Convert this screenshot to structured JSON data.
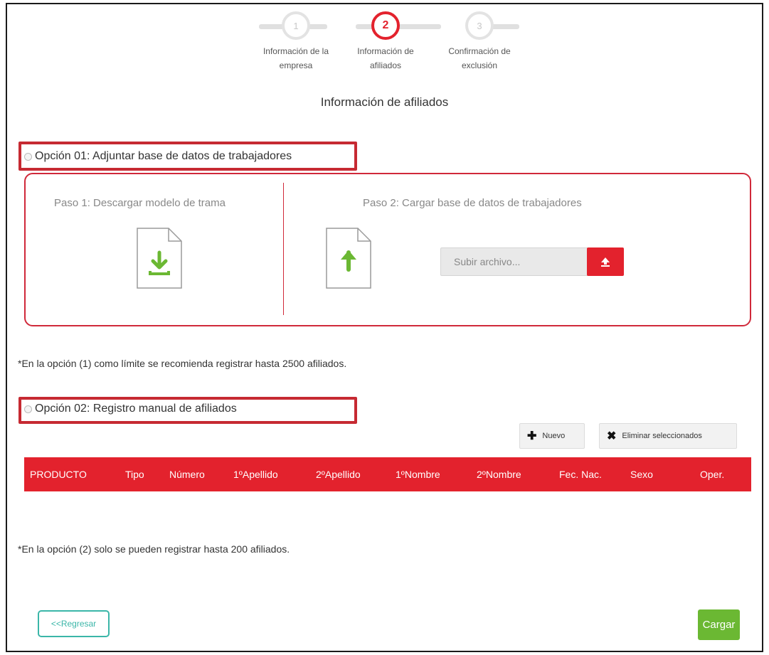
{
  "stepper": {
    "steps": [
      {
        "number": "1",
        "label": "Información de la\nempresa",
        "state": "inactive"
      },
      {
        "number": "2",
        "label": "Información de\nafiliados",
        "state": "active"
      },
      {
        "number": "3",
        "label": "Confirmación de\nexclusión",
        "state": "inactive"
      }
    ]
  },
  "page_title": "Información de afiliados",
  "option1": {
    "title": "Opción 01: Adjuntar base de datos de trabajadores",
    "step1_title": "Paso 1: Descargar modelo de trama",
    "step2_title": "Paso 2: Cargar base de datos de trabajadores",
    "file_input_text": "Subir archivo...",
    "note": "*En la opción (1) como límite se recomienda registrar hasta 2500 afiliados."
  },
  "option2": {
    "title": "Opción 02: Registro manual de afiliados",
    "new_button": "Nuevo",
    "delete_button": "Eliminar seleccionados",
    "columns": [
      "PRODUCTO",
      "Tipo",
      "Número",
      "1ºApellido",
      "2ºApellido",
      "1ºNombre",
      "2ºNombre",
      "Fec. Nac.",
      "Sexo",
      "Oper."
    ],
    "note": "*En la opción (2) solo se pueden registrar hasta 200 afiliados."
  },
  "footer": {
    "back_button": "<<Regresar",
    "submit_button": "Cargar"
  },
  "colors": {
    "accent_red": "#e3222d",
    "icon_green": "#6bb833",
    "back_teal": "#3bb6a8"
  }
}
